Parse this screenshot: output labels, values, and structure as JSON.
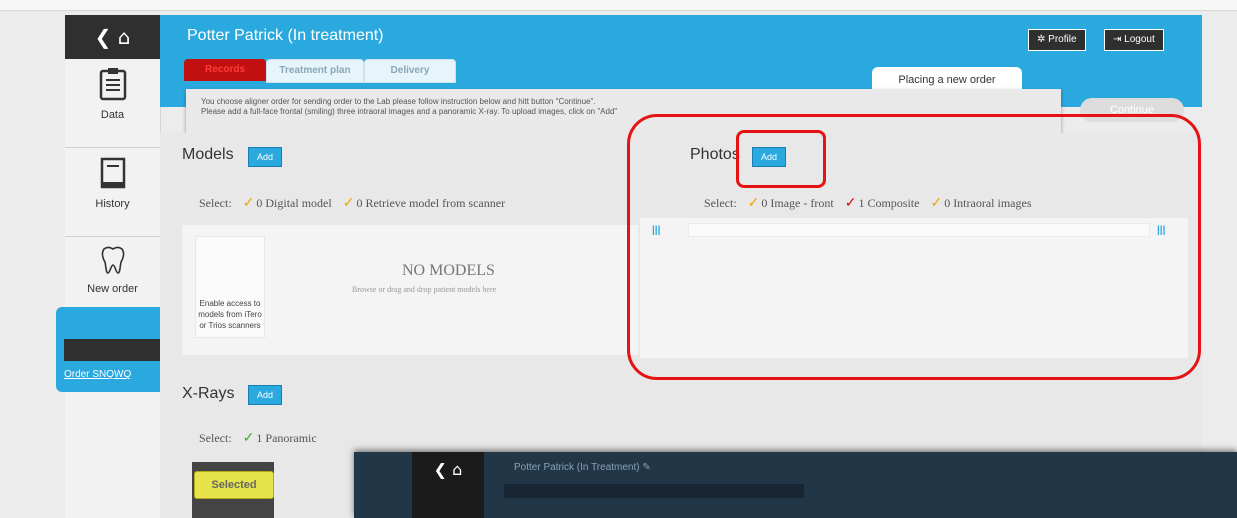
{
  "sidebar": {
    "top_glyph": "❮ ⌂",
    "items": [
      {
        "label": "Data",
        "icon": "clipboard-icon"
      },
      {
        "label": "History",
        "icon": "book-icon"
      },
      {
        "label": "New order",
        "icon": "tooth-icon"
      }
    ],
    "order_link": "Order SNQWQ"
  },
  "header": {
    "title": "Potter Patrick (In treatment)",
    "profile_label": "Profile",
    "logout_label": "Logout",
    "tabs": [
      "Records",
      "Treatment plan",
      "Delivery"
    ],
    "placing_order": "Placing a new order"
  },
  "notice": {
    "line1": "You choose aligner order for sending order to the Lab please follow instruction below and hitt button \"Continue\".",
    "line2": "Please add a full-face frontal (smiling) three intraoral images and a panoramic X-ray. To upload images, click on \"Add\"",
    "continue_label": "Continue"
  },
  "models": {
    "heading": "Models",
    "add_label": "Add",
    "select_label": "Select:",
    "options": [
      "0 Digital model",
      "0 Retrieve model from scanner"
    ],
    "scanner_card": "Enable access to models from iTero or Trios scanners",
    "empty_title": "NO MODELS",
    "empty_hint": "Browse or drag and drop patient models here"
  },
  "photos": {
    "heading": "Photos",
    "add_label": "Add",
    "select_label": "Select:",
    "options": [
      "0 Image - front",
      "1 Composite",
      "0 Intraoral images"
    ]
  },
  "xrays": {
    "heading": "X-Rays",
    "add_label": "Add",
    "select_label": "Select:",
    "options": [
      "1 Panoramic"
    ],
    "selected_badge": "Selected"
  },
  "overlay": {
    "title": "Potter Patrick (In Treatment) ✎"
  },
  "colors": {
    "accent": "#2aa9de",
    "dark": "#2f2f2f",
    "highlight": "#e51313"
  }
}
